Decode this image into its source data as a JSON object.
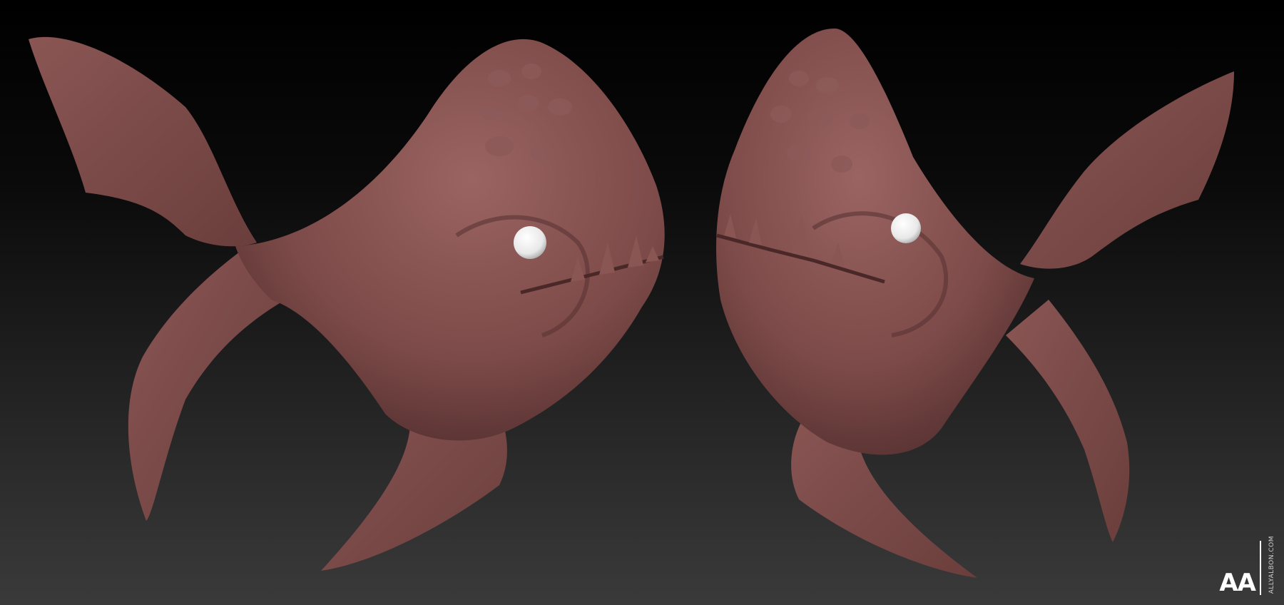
{
  "scene": {
    "description_colors": {
      "background_top": "#000000",
      "background_bottom": "#3a3a3a",
      "clay": "#7a4a48",
      "clay_highlight": "#9a6664",
      "clay_shadow": "#4a2a2a",
      "eye": "#f4f4f4"
    }
  },
  "watermark": {
    "logo": "AA",
    "url": "ALLYALBON.COM"
  }
}
